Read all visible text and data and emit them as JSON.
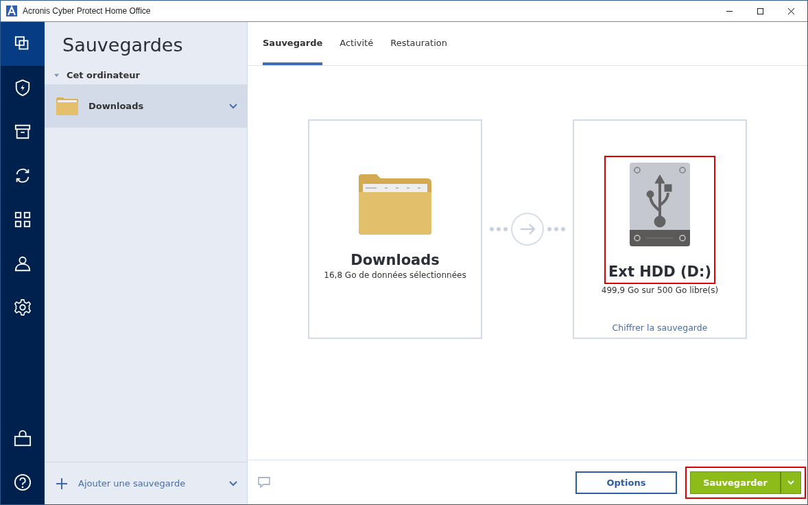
{
  "window": {
    "title": "Acronis Cyber Protect Home Office"
  },
  "nav": {
    "top": [
      {
        "selected": true
      },
      {
        "selected": false
      },
      {
        "selected": false
      },
      {
        "selected": false
      },
      {
        "selected": false
      },
      {
        "selected": false
      },
      {
        "selected": false
      }
    ],
    "bottom": [
      {
        "selected": false
      },
      {
        "selected": false
      }
    ]
  },
  "sidebar": {
    "title": "Sauvegardes",
    "group": {
      "label": "Cet ordinateur",
      "expanded": true
    },
    "items": [
      {
        "label": "Downloads",
        "selected": true
      }
    ],
    "add_label": "Ajouter une sauvegarde"
  },
  "tabs": [
    {
      "label": "Sauvegarde",
      "selected": true
    },
    {
      "label": "Activité",
      "selected": false
    },
    {
      "label": "Restauration",
      "selected": false
    }
  ],
  "source": {
    "name": "Downloads",
    "detail": "16,8 Go de données sélectionnées"
  },
  "destination": {
    "name": "Ext HDD (D:)",
    "detail": "499,9 Go sur 500 Go libre(s)",
    "link": "Chiffrer la sauvegarde",
    "highlighted": true
  },
  "footer": {
    "options_label": "Options",
    "save_label": "Sauvegarder",
    "save_highlighted": true
  }
}
